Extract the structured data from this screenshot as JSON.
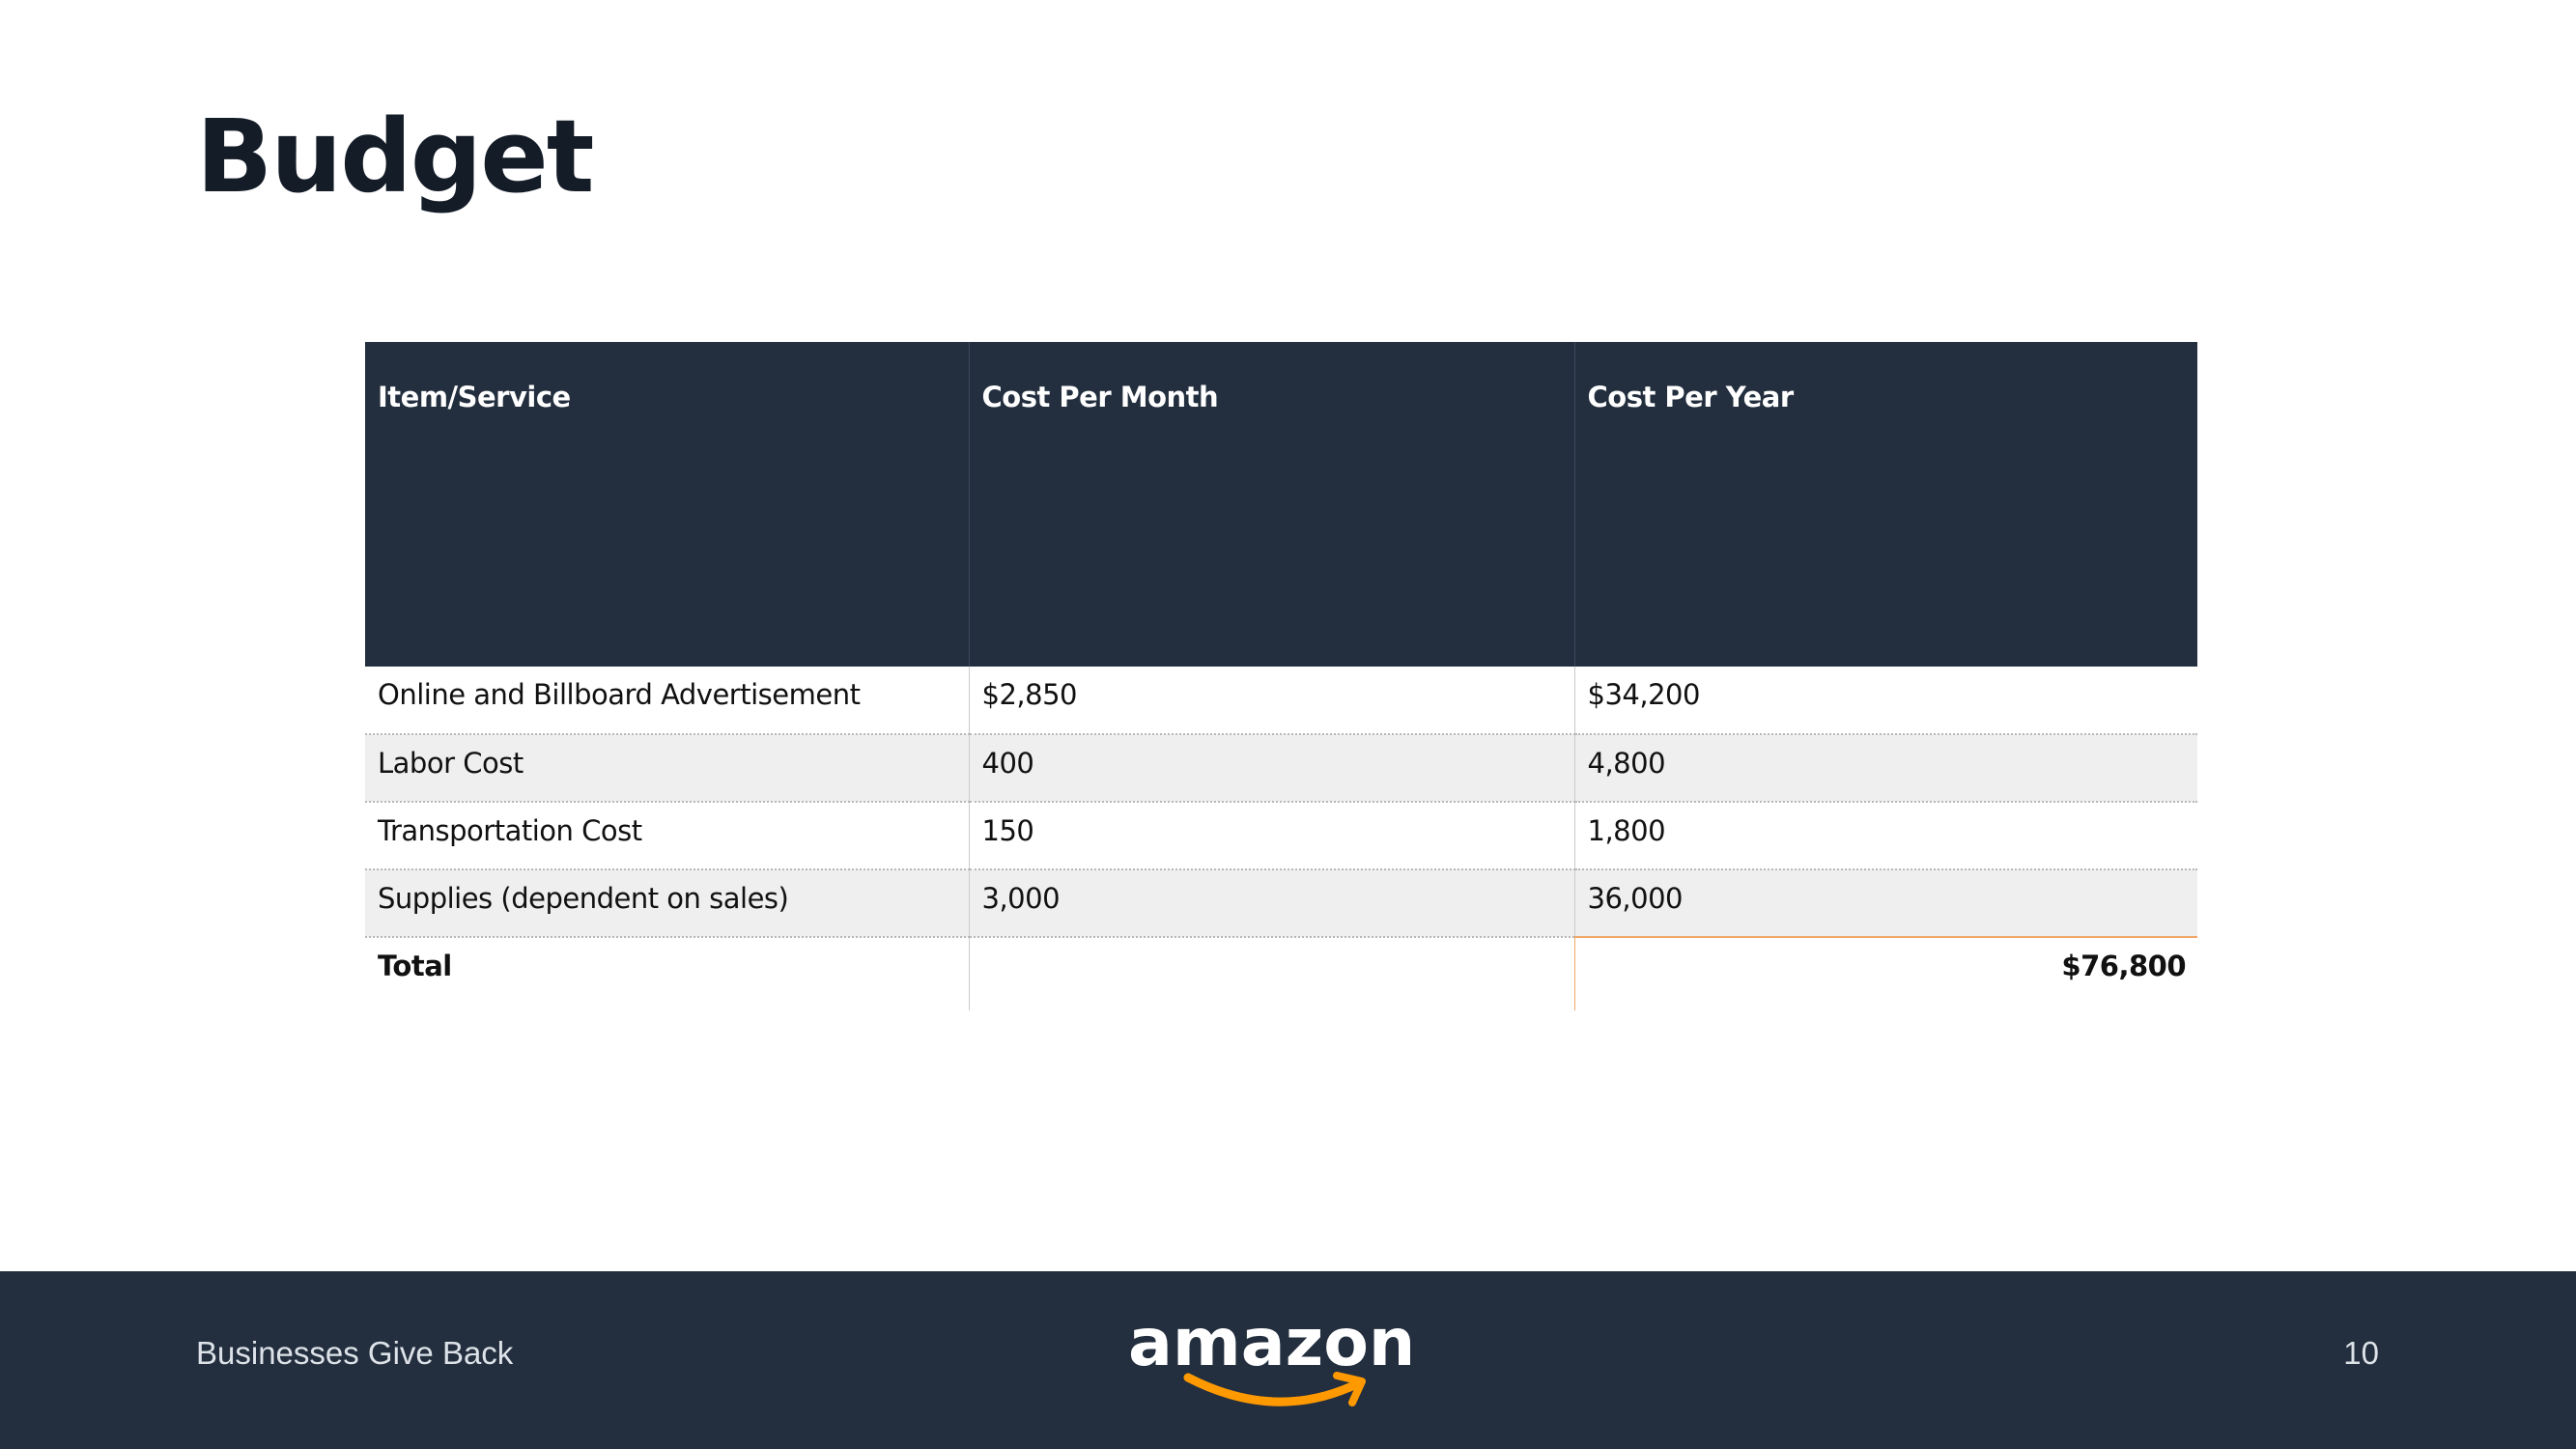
{
  "slide": {
    "title": "Budget"
  },
  "table": {
    "headers": [
      "Item/Service",
      "Cost Per Month",
      "Cost Per Year"
    ],
    "rows": [
      {
        "item": "Online and Billboard Advertisement",
        "month": "$2,850",
        "year": "$34,200"
      },
      {
        "item": "Labor Cost",
        "month": "400",
        "year": "4,800"
      },
      {
        "item": "Transportation Cost",
        "month": "150",
        "year": "1,800"
      },
      {
        "item": "Supplies (dependent on sales)",
        "month": "3,000",
        "year": "36,000"
      }
    ],
    "total": {
      "label": "Total",
      "month": "",
      "year": "$76,800"
    }
  },
  "footer": {
    "text": "Businesses Give Back",
    "logo": "amazon",
    "page_number": "10"
  },
  "colors": {
    "header_bg": "#232f3e",
    "footer_bg": "#232f3e",
    "title": "#141c28",
    "logo_smile": "#ff9900",
    "shaded_row": "#efefef"
  },
  "icons": {
    "logo": "amazon-smile-logo"
  }
}
